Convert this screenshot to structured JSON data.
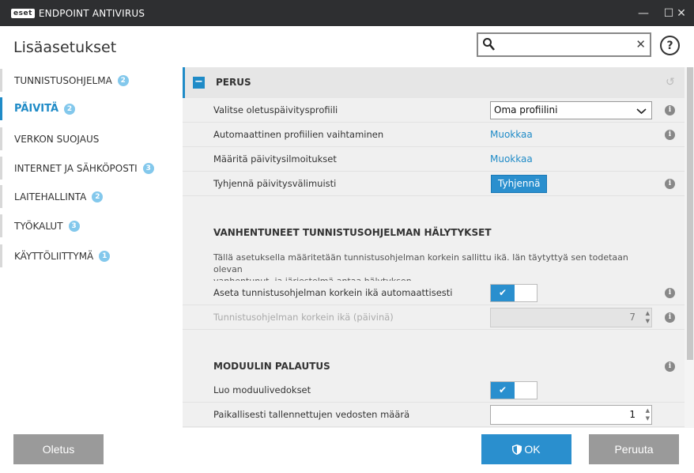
{
  "window": {
    "logo": "eset",
    "title": "ENDPOINT ANTIVIRUS",
    "minimize_glyph": "—",
    "maximize_glyph": "☐",
    "close_glyph": "✕"
  },
  "header": {
    "title": "Lisäasetukset",
    "search_value": "",
    "search_clear_glyph": "✕",
    "help_glyph": "?"
  },
  "sidebar": {
    "items": [
      {
        "label": "TUNNISTUSOHJELMA",
        "badge": "2"
      },
      {
        "label": "PÄIVITÄ",
        "badge": "2"
      },
      {
        "label": "VERKON SUOJAUS",
        "badge": ""
      },
      {
        "label": "INTERNET JA SÄHKÖPOSTI",
        "badge": "3"
      },
      {
        "label": "LAITEHALLINTA",
        "badge": "2"
      },
      {
        "label": "TYÖKALUT",
        "badge": "3"
      },
      {
        "label": "KÄYTTÖLIITTYMÄ",
        "badge": "1"
      }
    ],
    "active_index": 1
  },
  "main": {
    "perus": {
      "title": "PERUS",
      "collapse_glyph": "−",
      "undo_glyph": "↺",
      "rows": {
        "profile_label": "Valitse oletuspäivitysprofiili",
        "profile_value": "Oma profiilini",
        "auto_switch_label": "Automaattinen profiilien vaihtaminen",
        "auto_switch_link": "Muokkaa",
        "notifications_label": "Määritä päivitysilmoitukset",
        "notifications_link": "Muokkaa",
        "clear_cache_label": "Tyhjennä päivitysvälimuisti",
        "clear_cache_button": "Tyhjennä"
      }
    },
    "outdated": {
      "title": "VANHENTUNEET TUNNISTUSOHJELMAN HÄLYTYKSET",
      "description_line1": "Tällä asetuksella määritetään tunnistusohjelman korkein sallittu ikä. Iän täytyttyä sen todetaan olevan",
      "description_line2": "vanhentunut, ja järjestelmä antaa hälytyksen.",
      "auto_age_label": "Aseta tunnistusohjelman korkein ikä automaattisesti",
      "auto_age_enabled": true,
      "max_age_label": "Tunnistusohjelman korkein ikä (päivinä)",
      "max_age_value": "7"
    },
    "rollback": {
      "title": "MODUULIN PALAUTUS",
      "snapshots_label": "Luo moduulivedokset",
      "snapshots_enabled": true,
      "count_label": "Paikallisesti tallennettujen vedosten määrä",
      "count_value": "1"
    },
    "info_glyph": "i",
    "check_glyph": "✔"
  },
  "footer": {
    "default_button": "Oletus",
    "ok_button": "OK",
    "cancel_button": "Peruuta"
  },
  "colors": {
    "accent": "#1f8bc7",
    "titlebar": "#2e2f31",
    "badge": "#83c8ec",
    "button_gray": "#9a9a9a"
  }
}
